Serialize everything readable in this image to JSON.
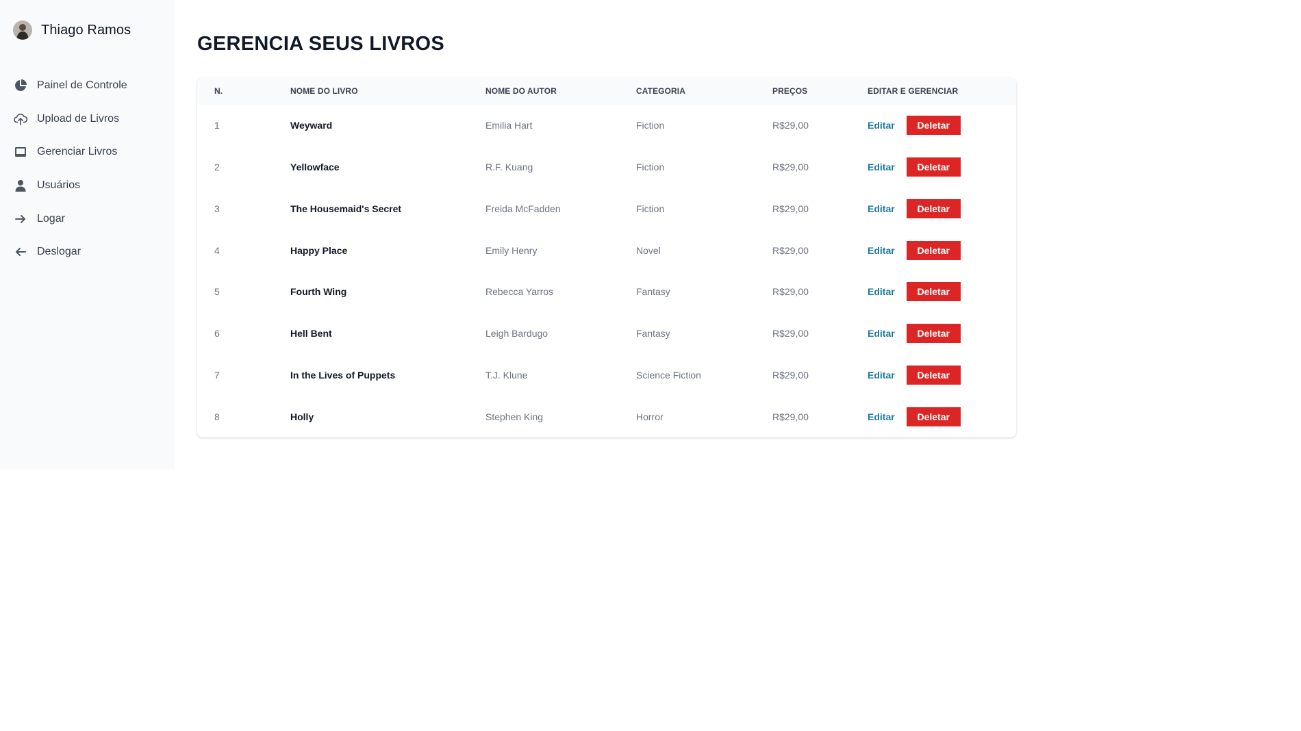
{
  "sidebar": {
    "user_name": "Thiago Ramos",
    "items": [
      {
        "label": "Painel de Controle",
        "icon": "pie-chart-icon"
      },
      {
        "label": "Upload de Livros",
        "icon": "cloud-upload-icon"
      },
      {
        "label": "Gerenciar Livros",
        "icon": "inbox-icon"
      },
      {
        "label": "Usuários",
        "icon": "user-icon"
      },
      {
        "label": "Logar",
        "icon": "arrow-right-icon"
      },
      {
        "label": "Deslogar",
        "icon": "arrow-left-icon"
      }
    ]
  },
  "main": {
    "title": "GERENCIA SEUS LIVROS",
    "table": {
      "headers": [
        "N.",
        "NOME DO LIVRO",
        "NOME DO AUTOR",
        "CATEGORIA",
        "PREÇOS",
        "EDITAR E GERENCIAR"
      ],
      "edit_label": "Editar",
      "delete_label": "Deletar",
      "rows": [
        {
          "n": "1",
          "book": "Weyward",
          "author": "Emilia Hart",
          "category": "Fiction",
          "price": "R$29,00"
        },
        {
          "n": "2",
          "book": "Yellowface",
          "author": "R.F. Kuang",
          "category": "Fiction",
          "price": "R$29,00"
        },
        {
          "n": "3",
          "book": "The Housemaid's Secret",
          "author": "Freida McFadden",
          "category": "Fiction",
          "price": "R$29,00"
        },
        {
          "n": "4",
          "book": "Happy Place",
          "author": "Emily Henry",
          "category": "Novel",
          "price": "R$29,00"
        },
        {
          "n": "5",
          "book": "Fourth Wing",
          "author": "Rebecca Yarros",
          "category": "Fantasy",
          "price": "R$29,00"
        },
        {
          "n": "6",
          "book": "Hell Bent",
          "author": "Leigh Bardugo",
          "category": "Fantasy",
          "price": "R$29,00"
        },
        {
          "n": "7",
          "book": "In the Lives of Puppets",
          "author": "T.J. Klune",
          "category": "Science Fiction",
          "price": "R$29,00"
        },
        {
          "n": "8",
          "book": "Holly",
          "author": "Stephen King",
          "category": "Horror",
          "price": "R$29,00"
        }
      ]
    }
  },
  "colors": {
    "sidebar_bg": "#f9fafb",
    "edit_link": "#1d7a9e",
    "delete_button": "#dc2626",
    "header_bg": "#f9fafb"
  }
}
